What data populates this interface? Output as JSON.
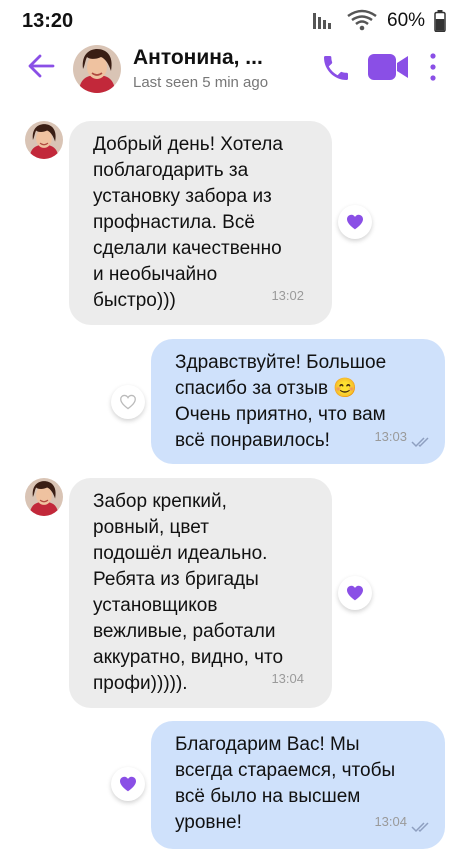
{
  "status_bar": {
    "time": "13:20",
    "battery": "60%"
  },
  "header": {
    "contact_name": "Антонина, ...",
    "last_seen": "Last seen 5 min ago"
  },
  "colors": {
    "accent": "#8a4fe6",
    "incoming_bubble": "#ececec",
    "outgoing_bubble": "#cfe1fb"
  },
  "messages": [
    {
      "direction": "incoming",
      "text": "Добрый день! Хотела\nпоблагодарить за\nустановку забора из\nпрофнастила. Всё\nсделали качественно\nи необычайно\nбыстро)))",
      "time": "13:02",
      "liked": true
    },
    {
      "direction": "outgoing",
      "text": "Здравствуйте! Большое\nспасибо за отзыв 😊\nОчень приятно, что вам\nвсё понравилось!",
      "time": "13:03",
      "liked": false
    },
    {
      "direction": "incoming",
      "text": "Забор крепкий,\nровный, цвет\nподошёл идеально.\nРебята из бригады\nустановщиков\nвежливые, работали\nаккуратно, видно, что\nпрофи))))).",
      "time": "13:04",
      "liked": true
    },
    {
      "direction": "outgoing",
      "text": "Благодарим Вас! Мы\nвсегда стараемся, чтобы\nвсё было на высшем\nуровне!",
      "time": "13:04",
      "liked": true
    }
  ]
}
